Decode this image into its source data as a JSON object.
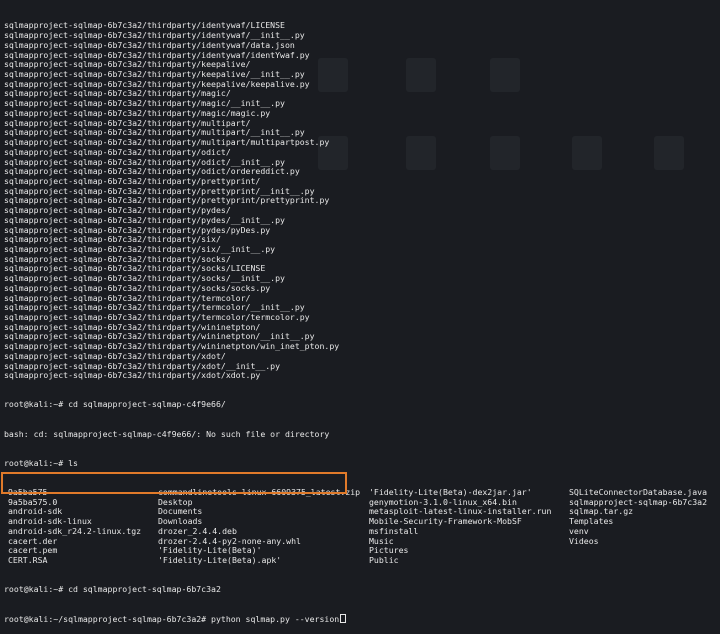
{
  "terminal": {
    "listing_lines": [
      "sqlmapproject-sqlmap-6b7c3a2/thirdparty/identywaf/LICENSE",
      "sqlmapproject-sqlmap-6b7c3a2/thirdparty/identywaf/__init__.py",
      "sqlmapproject-sqlmap-6b7c3a2/thirdparty/identywaf/data.json",
      "sqlmapproject-sqlmap-6b7c3a2/thirdparty/identywaf/identYwaf.py",
      "sqlmapproject-sqlmap-6b7c3a2/thirdparty/keepalive/",
      "sqlmapproject-sqlmap-6b7c3a2/thirdparty/keepalive/__init__.py",
      "sqlmapproject-sqlmap-6b7c3a2/thirdparty/keepalive/keepalive.py",
      "sqlmapproject-sqlmap-6b7c3a2/thirdparty/magic/",
      "sqlmapproject-sqlmap-6b7c3a2/thirdparty/magic/__init__.py",
      "sqlmapproject-sqlmap-6b7c3a2/thirdparty/magic/magic.py",
      "sqlmapproject-sqlmap-6b7c3a2/thirdparty/multipart/",
      "sqlmapproject-sqlmap-6b7c3a2/thirdparty/multipart/__init__.py",
      "sqlmapproject-sqlmap-6b7c3a2/thirdparty/multipart/multipartpost.py",
      "sqlmapproject-sqlmap-6b7c3a2/thirdparty/odict/",
      "sqlmapproject-sqlmap-6b7c3a2/thirdparty/odict/__init__.py",
      "sqlmapproject-sqlmap-6b7c3a2/thirdparty/odict/ordereddict.py",
      "sqlmapproject-sqlmap-6b7c3a2/thirdparty/prettyprint/",
      "sqlmapproject-sqlmap-6b7c3a2/thirdparty/prettyprint/__init__.py",
      "sqlmapproject-sqlmap-6b7c3a2/thirdparty/prettyprint/prettyprint.py",
      "sqlmapproject-sqlmap-6b7c3a2/thirdparty/pydes/",
      "sqlmapproject-sqlmap-6b7c3a2/thirdparty/pydes/__init__.py",
      "sqlmapproject-sqlmap-6b7c3a2/thirdparty/pydes/pyDes.py",
      "sqlmapproject-sqlmap-6b7c3a2/thirdparty/six/",
      "sqlmapproject-sqlmap-6b7c3a2/thirdparty/six/__init__.py",
      "sqlmapproject-sqlmap-6b7c3a2/thirdparty/socks/",
      "sqlmapproject-sqlmap-6b7c3a2/thirdparty/socks/LICENSE",
      "sqlmapproject-sqlmap-6b7c3a2/thirdparty/socks/__init__.py",
      "sqlmapproject-sqlmap-6b7c3a2/thirdparty/socks/socks.py",
      "sqlmapproject-sqlmap-6b7c3a2/thirdparty/termcolor/",
      "sqlmapproject-sqlmap-6b7c3a2/thirdparty/termcolor/__init__.py",
      "sqlmapproject-sqlmap-6b7c3a2/thirdparty/termcolor/termcolor.py",
      "sqlmapproject-sqlmap-6b7c3a2/thirdparty/wininetpton/",
      "sqlmapproject-sqlmap-6b7c3a2/thirdparty/wininetpton/__init__.py",
      "sqlmapproject-sqlmap-6b7c3a2/thirdparty/wininetpton/win_inet_pton.py",
      "sqlmapproject-sqlmap-6b7c3a2/thirdparty/xdot/",
      "sqlmapproject-sqlmap-6b7c3a2/thirdparty/xdot/__init__.py",
      "sqlmapproject-sqlmap-6b7c3a2/thirdparty/xdot/xdot.py"
    ],
    "cmd_cd_fail": "root@kali:~# cd sqlmapproject-sqlmap-c4f9e66/",
    "error_line": "bash: cd: sqlmapproject-sqlmap-c4f9e66/: No such file or directory",
    "cmd_ls": "root@kali:~# ls",
    "ls_rows": [
      [
        "9a5ba575",
        "commandlinetools-linux-6609375_latest.zip",
        "'Fidelity-Lite(Beta)-dex2jar.jar'",
        "SQLiteConnectorDatabase.java"
      ],
      [
        "9a5ba575.0",
        "Desktop",
        "genymotion-3.1.0-linux_x64.bin",
        "sqlmapproject-sqlmap-6b7c3a2"
      ],
      [
        "android-sdk",
        "Documents",
        "metasploit-latest-linux-installer.run",
        "sqlmap.tar.gz"
      ],
      [
        "android-sdk-linux",
        "Downloads",
        "Mobile-Security-Framework-MobSF",
        "Templates"
      ],
      [
        "android-sdk_r24.2-linux.tgz",
        "drozer_2.4.4.deb",
        "msfinstall",
        "venv"
      ],
      [
        "cacert.der",
        "drozer-2.4.4-py2-none-any.whl",
        "Music",
        "Videos"
      ],
      [
        "cacert.pem",
        "'Fidelity-Lite(Beta)'",
        "Pictures",
        ""
      ],
      [
        "CERT.RSA",
        "'Fidelity-Lite(Beta).apk'",
        "Public",
        ""
      ]
    ],
    "cmd_cd_ok": "root@kali:~# cd sqlmapproject-sqlmap-6b7c3a2",
    "cmd_run": "root@kali:~/sqlmapproject-sqlmap-6b7c3a2# python sqlmap.py --version"
  },
  "colors": {
    "background": "#1a1c21",
    "text": "#e8e8e8",
    "highlight_border": "#e07a2a"
  }
}
